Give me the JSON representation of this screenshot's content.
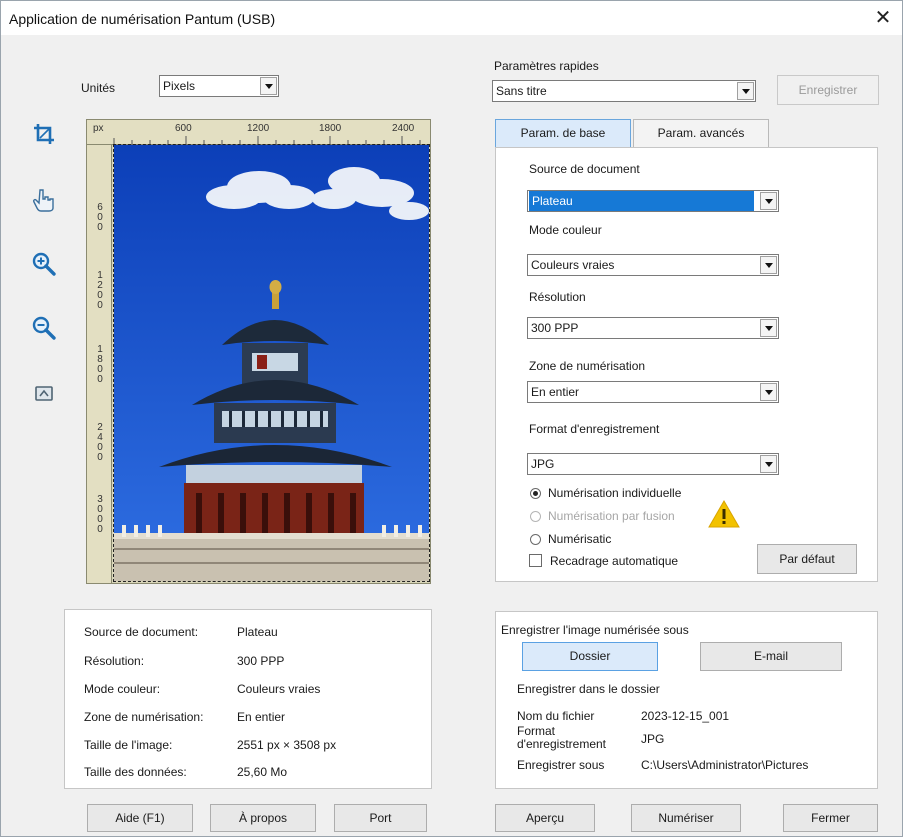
{
  "window": {
    "title": "Application de numérisation Pantum (USB)",
    "close_glyph": "✕"
  },
  "units": {
    "label": "Unités",
    "value": "Pixels"
  },
  "toolbar": {
    "icons": [
      "crop-icon",
      "hand-pointer-icon",
      "zoom-in-icon",
      "zoom-out-icon",
      "reset-view-icon"
    ]
  },
  "ruler": {
    "unit": "px",
    "h_ticks": [
      "600",
      "1200",
      "1800",
      "2400"
    ],
    "v_ticks": [
      "600",
      "1200",
      "1800",
      "2400",
      "3000"
    ]
  },
  "quick_params": {
    "label": "Paramètres rapides",
    "value": "Sans titre",
    "save_label": "Enregistrer"
  },
  "tabs": [
    {
      "label": "Param. de base",
      "active": true
    },
    {
      "label": "Param. avancés",
      "active": false
    }
  ],
  "basic": {
    "source_label": "Source de document",
    "source_value": "Plateau",
    "color_label": "Mode couleur",
    "color_value": "Couleurs vraies",
    "resolution_label": "Résolution",
    "resolution_value": "300 PPP",
    "zone_label": "Zone de numérisation",
    "zone_value": "En entier",
    "format_label": "Format d'enregistrement",
    "format_value": "JPG",
    "radio_individual": "Numérisation individuelle",
    "radio_fusion": "Numérisation par fusion",
    "radio_other": "Numérisatic",
    "auto_crop": "Recadrage automatique",
    "default_button": "Par défaut"
  },
  "info": {
    "rows": [
      {
        "label": "Source de document:",
        "value": "Plateau"
      },
      {
        "label": "Résolution:",
        "value": "300 PPP"
      },
      {
        "label": "Mode couleur:",
        "value": "Couleurs vraies"
      },
      {
        "label": "Zone de numérisation:",
        "value": "En entier"
      },
      {
        "label": "Taille de l'image:",
        "value": "2551 px × 3508 px"
      },
      {
        "label": "Taille des données:",
        "value": "25,60 Mo"
      }
    ]
  },
  "save": {
    "title": "Enregistrer l'image numérisée sous",
    "folder_button": "Dossier",
    "email_button": "E-mail",
    "save_in_folder": "Enregistrer dans le dossier",
    "filename_label": "Nom du fichier",
    "filename_value": "2023-12-15_001",
    "format_label": "Format d'enregistrement",
    "format_value": "JPG",
    "save_as_label": "Enregistrer sous",
    "save_as_value": "C:\\Users\\Administrator\\Pictures"
  },
  "bottom_buttons": {
    "help": "Aide (F1)",
    "about": "À propos",
    "port": "Port",
    "preview": "Aperçu",
    "scan": "Numériser",
    "close": "Fermer"
  },
  "colors": {
    "accent": "#1679d6",
    "active_tab": "#dbeafa",
    "toolbar_icon": "#1f6fb5",
    "warning": "#f2c200"
  }
}
